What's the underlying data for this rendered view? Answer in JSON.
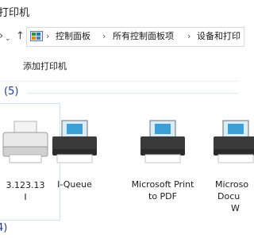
{
  "window": {
    "title": "打印机"
  },
  "nav": {
    "forward_icon": "chevron-right-icon",
    "down_icon": "chevron-down-icon",
    "up_icon": "arrow-up-icon"
  },
  "address": {
    "icon": "control-panel-icon",
    "segments": [
      "控制面板",
      "所有控制面板项",
      "设备和打印"
    ],
    "separator": "›"
  },
  "commands": {
    "add_printer": "添加打印机"
  },
  "printers_group": {
    "count": "(5)"
  },
  "printers": [
    {
      "line1": "3.123.13",
      "line2": "I",
      "selected": true
    },
    {
      "line1": "I-Queue",
      "line2": "",
      "selected": false
    },
    {
      "line1": "Microsoft Print",
      "line2": "to PDF",
      "selected": false
    },
    {
      "line1": "Microso",
      "line2": "Docu",
      "line3": "W",
      "selected": false
    }
  ],
  "bottom_group": {
    "count": "4)"
  },
  "colors": {
    "accent": "#1e3d8f",
    "selection_border": "#cce4f7"
  }
}
